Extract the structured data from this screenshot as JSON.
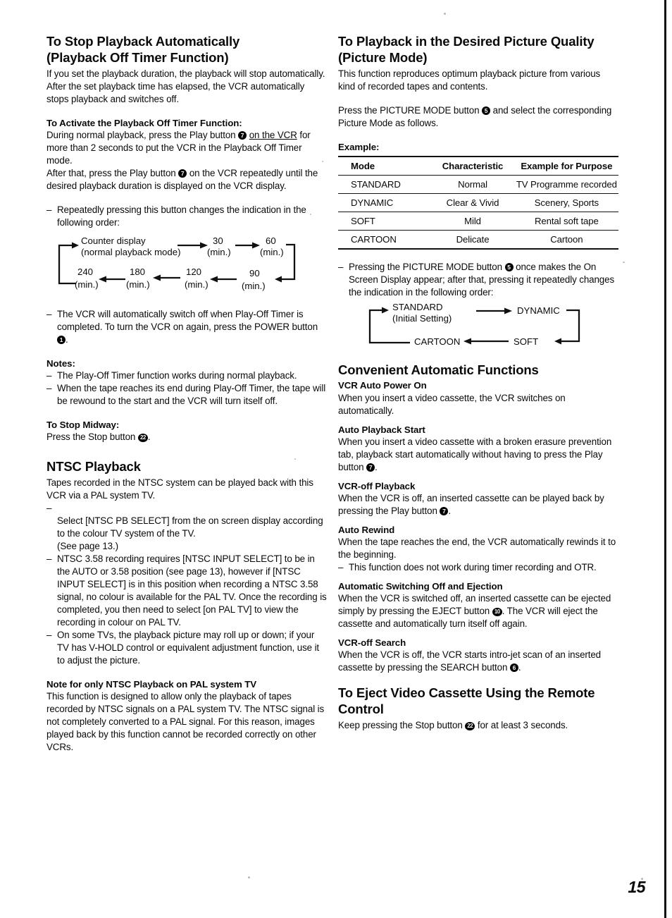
{
  "page": {
    "folio": "15"
  },
  "left_column": {
    "section1": {
      "heading_line1": "To Stop Playback Automatically",
      "heading_line2": "(Playback Off Timer Function)",
      "intro": "If you set the playback duration, the playback will stop automatically.\nAfter the set playback time has elapsed, the VCR automatically stops playback and switches off.",
      "activate_heading": "To Activate the Playback Off Timer Function:",
      "activate_p1_a": "During normal playback, press the Play button ",
      "activate_badge1": "7",
      "activate_p1_underlined": "on the VCR",
      "activate_p1_b": " for more than 2 seconds to put the VCR in the Playback Off Timer mode.",
      "activate_p2_a": "After that, press the Play button ",
      "activate_badge2": "7",
      "activate_p2_b": " on the VCR repeatedly until the desired playback duration is displayed on the VCR display.",
      "repeat_note": "Repeatedly pressing this button changes the indication in the following order:",
      "poweroff_note_a": "The VCR will automatically switch off when Play-Off Timer is completed. To turn the VCR on again, press the POWER button ",
      "poweroff_badge": "1",
      "poweroff_note_b": ".",
      "notes_heading": "Notes:",
      "note1": "The Play-Off Timer function works during normal playback.",
      "note2": "When the tape reaches its end during Play-Off Timer, the tape will be rewound to the start and the VCR will turn itself off.",
      "midway_heading": "To Stop Midway:",
      "midway_text_a": "Press the Stop button ",
      "midway_badge": "22",
      "midway_text_b": "."
    },
    "timer_diagram": {
      "node_counter_line1": "Counter display",
      "node_counter_line2": "(normal playback mode)",
      "node_30_value": "30",
      "node_30_unit": "(min.)",
      "node_60_value": "60",
      "node_60_unit": "(min.)",
      "node_90_value": "90",
      "node_90_unit": "(min.)",
      "node_120_value": "120",
      "node_120_unit": "(min.)",
      "node_180_value": "180",
      "node_180_unit": "(min.)",
      "node_240_value": "240",
      "node_240_unit": "(min.)"
    },
    "section2": {
      "heading": "NTSC Playback",
      "intro": "Tapes recorded in the NTSC system can be played back with this VCR via a PAL system TV.",
      "bullet1": "Select [NTSC PB SELECT] from the on screen display according to the colour TV system of the TV.\n(See page 13.)",
      "bullet2": "NTSC 3.58 recording requires [NTSC INPUT SELECT] to be in the AUTO or 3.58 position (see page 13), however if [NTSC INPUT SELECT] is in this position when recording a NTSC 3.58 signal, no colour is available for the PAL TV. Once the recording is completed, you then need to select [on PAL TV] to view the recording in colour on PAL TV.",
      "bullet3": "On some TVs, the playback picture may roll up or down; if your TV has V-HOLD control or equivalent adjustment function, use it to adjust the picture.",
      "note_heading": "Note for only NTSC Playback on PAL system TV",
      "note_body": "This function is designed to allow only the playback of tapes recorded by NTSC signals on a PAL system TV. The NTSC signal is not completely converted to a PAL signal. For this reason, images played back by this function cannot be recorded correctly on other VCRs."
    }
  },
  "right_column": {
    "section1": {
      "heading_line1": "To Playback in the Desired Picture Quality",
      "heading_line2": "(Picture Mode)",
      "intro": "This function reproduces optimum playback picture from various kind of recorded tapes and contents.",
      "press_a": "Press the PICTURE MODE button ",
      "press_badge": "5",
      "press_b": " and select the corresponding Picture Mode as follows.",
      "example_label": "Example:"
    },
    "picture_mode_table": {
      "headers": [
        "Mode",
        "Characteristic",
        "Example for Purpose"
      ],
      "rows": [
        [
          "STANDARD",
          "Normal",
          "TV Programme recorded"
        ],
        [
          "DYNAMIC",
          "Clear & Vivid",
          "Scenery, Sports"
        ],
        [
          "SOFT",
          "Mild",
          "Rental soft tape"
        ],
        [
          "CARTOON",
          "Delicate",
          "Cartoon"
        ]
      ]
    },
    "osd_note": {
      "text_a": "Pressing the PICTURE MODE button ",
      "badge": "5",
      "text_b": " once makes the On Screen Display appear; after that, pressing it repeatedly changes the indication in the following order:"
    },
    "mode_diagram": {
      "node_standard_line1": "STANDARD",
      "node_standard_line2": "(Initial Setting)",
      "node_dynamic": "DYNAMIC",
      "node_soft": "SOFT",
      "node_cartoon": "CARTOON"
    },
    "section2": {
      "heading": "Convenient Automatic Functions",
      "items": [
        {
          "title": "VCR Auto Power On",
          "body": "When you insert a video cassette, the VCR switches on automatically."
        },
        {
          "title": "Auto Playback Start",
          "body_a": "When you insert a video cassette with a broken erasure prevention tab, playback start automatically without having to press the Play button ",
          "badge": "7",
          "body_b": "."
        },
        {
          "title": "VCR-off Playback",
          "body_a": "When the VCR is off, an inserted cassette can be played back by pressing the Play button ",
          "badge": "7",
          "body_b": "."
        },
        {
          "title": "Auto Rewind",
          "body": "When the tape reaches the end, the VCR automatically rewinds it to the beginning.",
          "bullet": "This function does not work during timer recording and OTR."
        },
        {
          "title": "Automatic Switching Off and Ejection",
          "body_a": "When the VCR is switched off, an inserted cassette can be ejected simply by pressing the EJECT button ",
          "badge": "10",
          "body_b": ". The VCR will eject the cassette and automatically turn itself off again."
        },
        {
          "title": "VCR-off Search",
          "body_a": "When the VCR is off, the VCR starts intro-jet scan of an inserted cassette by pressing the SEARCH button ",
          "badge": "6",
          "body_b": "."
        }
      ]
    },
    "section3": {
      "heading_line1": "To Eject Video Cassette Using the Remote",
      "heading_line2": "Control",
      "body_a": "Keep pressing the Stop button ",
      "badge": "22",
      "body_b": " for at least 3 seconds."
    }
  }
}
